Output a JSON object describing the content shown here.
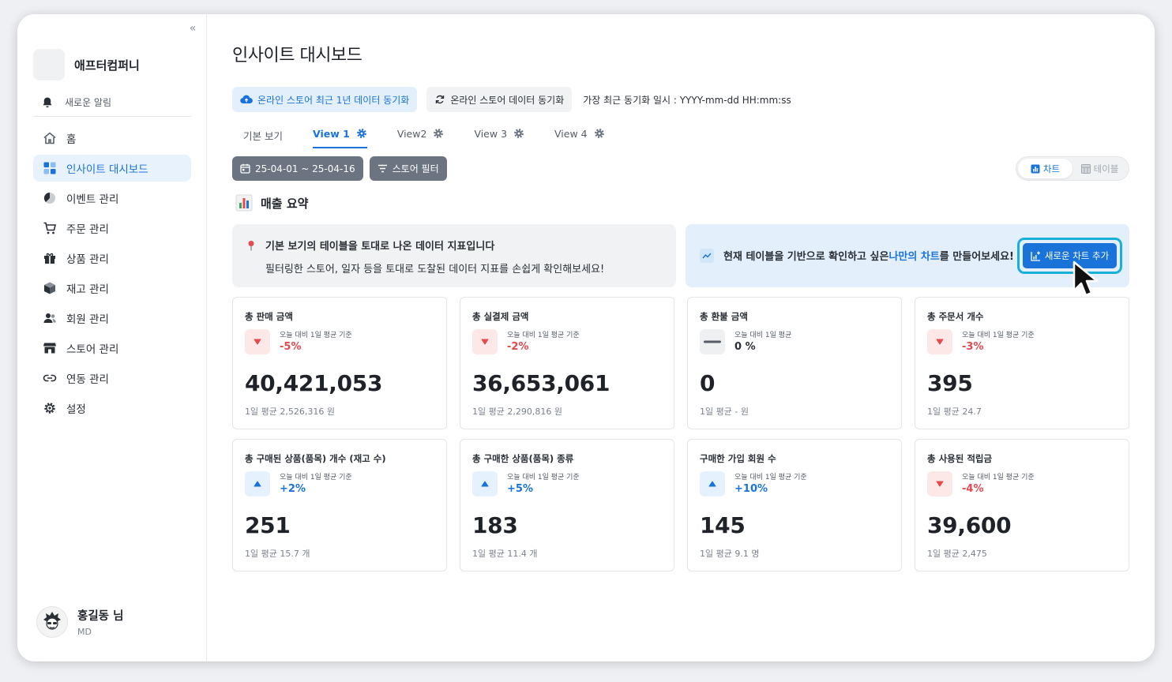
{
  "company": {
    "name": "애프터컴퍼니"
  },
  "notification": {
    "label": "새로운 알림"
  },
  "nav": [
    {
      "label": "홈",
      "icon": "home-icon",
      "active": false
    },
    {
      "label": "인사이트 대시보드",
      "icon": "dashboard-icon",
      "active": true
    },
    {
      "label": "이벤트 관리",
      "icon": "pie-icon",
      "active": false
    },
    {
      "label": "주문 관리",
      "icon": "cart-icon",
      "active": false
    },
    {
      "label": "상품 관리",
      "icon": "gift-icon",
      "active": false
    },
    {
      "label": "재고 관리",
      "icon": "box-icon",
      "active": false
    },
    {
      "label": "회원 관리",
      "icon": "users-icon",
      "active": false
    },
    {
      "label": "스토어 관리",
      "icon": "store-icon",
      "active": false
    },
    {
      "label": "연동 관리",
      "icon": "link-icon",
      "active": false
    },
    {
      "label": "설정",
      "icon": "gear-icon",
      "active": false
    }
  ],
  "user": {
    "name": "홍길동 님",
    "role": "MD"
  },
  "page": {
    "title": "인사이트 대시보드"
  },
  "sync": {
    "year_sync_label": "온라인 스토어 최근 1년 데이터 동기화",
    "sync_label": "온라인 스토어 데이터 동기화",
    "last_sync": "가장 최근 동기화 일시 : YYYY-mm-dd HH:mm:ss"
  },
  "tabs": [
    {
      "label": "기본 보기",
      "gear": false,
      "active": false
    },
    {
      "label": "View 1",
      "gear": true,
      "active": true
    },
    {
      "label": "View2",
      "gear": true,
      "active": false
    },
    {
      "label": "View 3",
      "gear": true,
      "active": false
    },
    {
      "label": "View 4",
      "gear": true,
      "active": false
    }
  ],
  "filters": {
    "date_range": "25-04-01 ~ 25-04-16",
    "store_filter": "스토어 필터"
  },
  "view_toggle": {
    "chart": "차트",
    "table": "테이블"
  },
  "section": {
    "title": "매출 요약"
  },
  "info_left": {
    "title": "기본 보기의 테이블을 토대로 나온 데이터 지표입니다",
    "desc": "필터링한 스토어, 일자 등을 토대로 도찰된 데이터 지표를 손쉽게 확인해보세요!"
  },
  "info_right": {
    "pre": "현재 테이블을 기반으로 확인하고 싶은 ",
    "highlight": "나만의 차트",
    "post": "를 만들어보세요!",
    "button": "새로운 차트 추가"
  },
  "colors": {
    "accent": "#1a73d9",
    "down": "#e5484d",
    "highlight_border": "#18b0d6"
  },
  "cards": [
    {
      "title": "총 판매 금액",
      "cmp_label": "오늘 대비 1일 평균 기준",
      "cmp_value": "-5%",
      "trend": "down",
      "value": "40,421,053",
      "avg": "1일 평균 2,526,316 원"
    },
    {
      "title": "총 실결제 금액",
      "cmp_label": "오늘 대비 1일 평균 기준",
      "cmp_value": "-2%",
      "trend": "down",
      "value": "36,653,061",
      "avg": "1일 평균 2,290,816 원"
    },
    {
      "title": "총 환불 금액",
      "cmp_label": "오늘 대비 1일 평균",
      "cmp_value": "0 %",
      "trend": "flat",
      "value": "0",
      "avg": "1일 평균 - 원"
    },
    {
      "title": "총 주문서 개수",
      "cmp_label": "오늘 대비 1일 평균 기준",
      "cmp_value": "-3%",
      "trend": "down",
      "value": "395",
      "avg": "1일 평균 24.7"
    },
    {
      "title": "총 구매된 상품(품목) 개수 (재고 수)",
      "cmp_label": "오늘 대비 1일 평균 기준",
      "cmp_value": "+2%",
      "trend": "up",
      "value": "251",
      "avg": "1일 평균 15.7 개"
    },
    {
      "title": "총 구매한 상품(품목) 종류",
      "cmp_label": "오늘 대비 1일 평균 기준",
      "cmp_value": "+5%",
      "trend": "up",
      "value": "183",
      "avg": "1일 평균 11.4 개"
    },
    {
      "title": "구매한 가입 회원 수",
      "cmp_label": "오늘 대비 1일 평균 기준",
      "cmp_value": "+10%",
      "trend": "up",
      "value": "145",
      "avg": "1일 평균 9.1 명"
    },
    {
      "title": "총 사용된 적립금",
      "cmp_label": "오늘 대비 1일 평균 기준",
      "cmp_value": "-4%",
      "trend": "down",
      "value": "39,600",
      "avg": "1일 평균 2,475"
    }
  ]
}
